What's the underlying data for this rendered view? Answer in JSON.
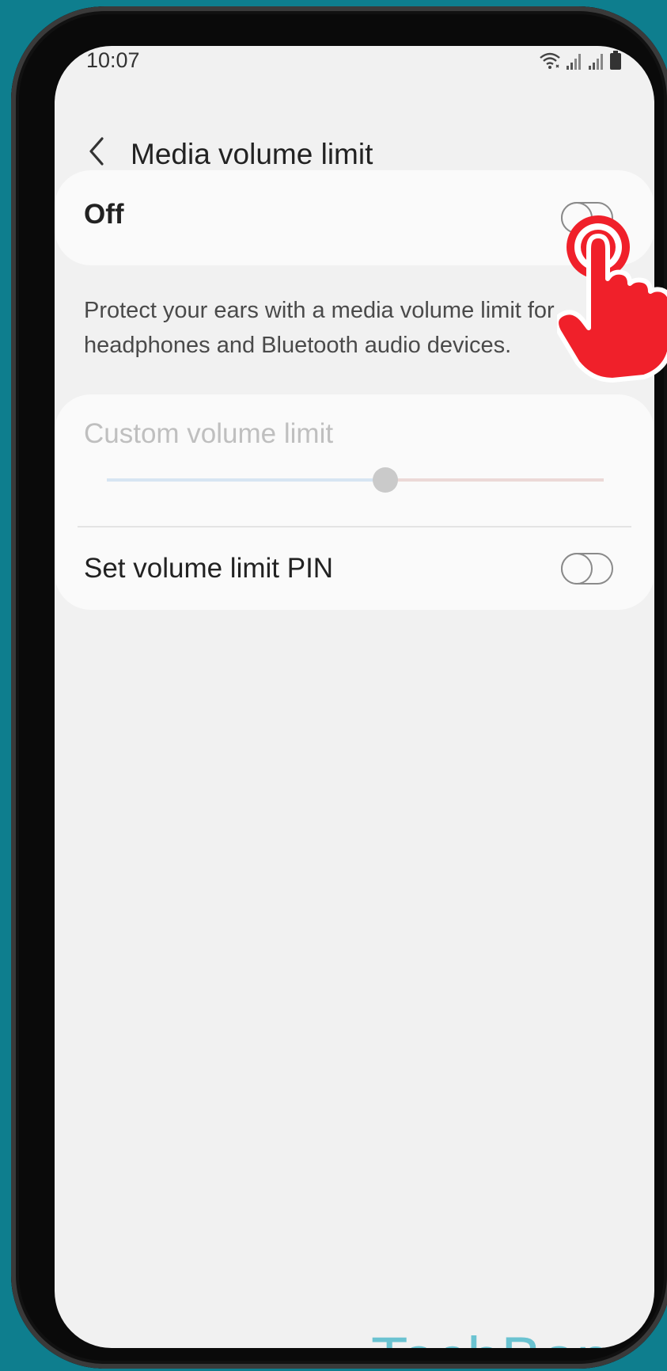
{
  "status_bar": {
    "time": "10:07",
    "icons": [
      "wifi-icon",
      "signal-icon",
      "signal-icon",
      "battery-icon"
    ]
  },
  "app_bar": {
    "back_icon": "chevron-left-icon",
    "title": "Media volume limit"
  },
  "master_switch": {
    "label": "Off",
    "state": "off"
  },
  "description": "Protect your ears with a media volume limit for headphones and Bluetooth audio devices.",
  "custom_volume": {
    "label": "Custom volume limit",
    "enabled": false,
    "level": 0.56
  },
  "pin": {
    "label": "Set volume limit PIN",
    "state": "off"
  },
  "overlay": {
    "tap_indicator_icon": "tap-hand-icon"
  },
  "watermark": "TechBone",
  "colors": {
    "background": "#0e7e8e",
    "screen": "#f1f1f1",
    "card": "#fafafa",
    "tap_indicator": "#f0202a",
    "watermark": "#6bc3d1"
  }
}
